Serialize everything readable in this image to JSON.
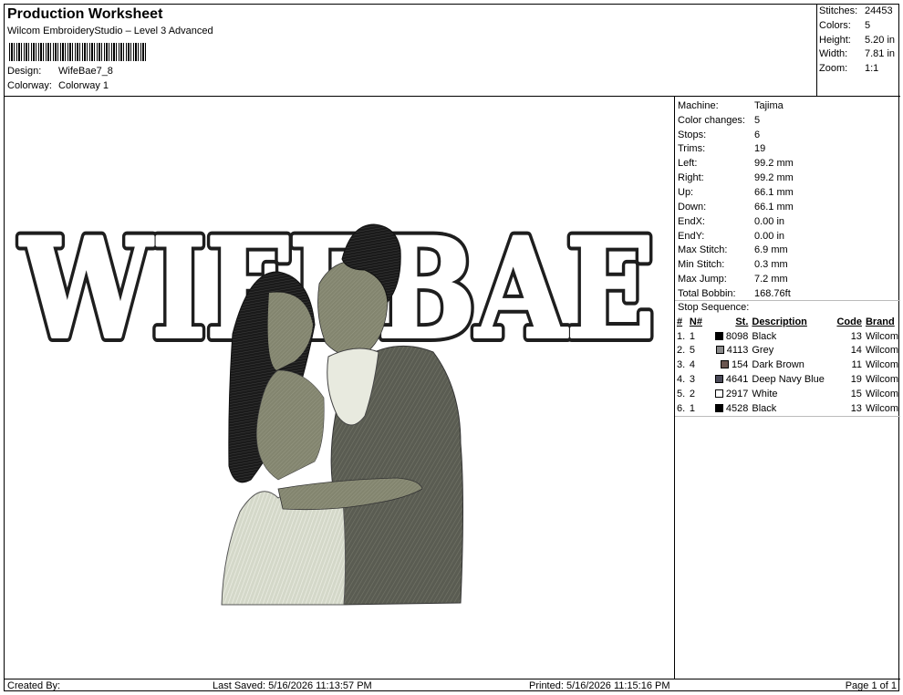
{
  "header": {
    "title": "Production Worksheet",
    "subtitle": "Wilcom EmbroideryStudio – Level 3 Advanced",
    "design_label": "Design:",
    "design_value": "WifeBae7_8",
    "colorway_label": "Colorway:",
    "colorway_value": "Colorway 1"
  },
  "stats": [
    {
      "label": "Stitches:",
      "value": "24453"
    },
    {
      "label": "Colors:",
      "value": "5"
    },
    {
      "label": "Height:",
      "value": "5.20 in"
    },
    {
      "label": "Width:",
      "value": "7.81 in"
    },
    {
      "label": "Zoom:",
      "value": "1:1"
    }
  ],
  "machine_info": [
    {
      "label": "Machine:",
      "value": "Tajima"
    },
    {
      "label": "Color changes:",
      "value": "5"
    },
    {
      "label": "Stops:",
      "value": "6"
    },
    {
      "label": "Trims:",
      "value": "19"
    },
    {
      "label": "Left:",
      "value": "99.2 mm"
    },
    {
      "label": "Right:",
      "value": "99.2 mm"
    },
    {
      "label": "Up:",
      "value": "66.1 mm"
    },
    {
      "label": "Down:",
      "value": "66.1 mm"
    },
    {
      "label": "EndX:",
      "value": "0.00 in"
    },
    {
      "label": "EndY:",
      "value": "0.00 in"
    },
    {
      "label": "Max Stitch:",
      "value": "6.9 mm"
    },
    {
      "label": "Min Stitch:",
      "value": "0.3 mm"
    },
    {
      "label": "Max Jump:",
      "value": "7.2 mm"
    },
    {
      "label": "Total Bobbin:",
      "value": "168.76ft"
    }
  ],
  "stop_sequence": {
    "title": "Stop Sequence:",
    "columns": [
      "#",
      "N#",
      "St.",
      "Description",
      "Code",
      "Brand"
    ],
    "rows": [
      {
        "idx": "1.",
        "n": "1",
        "st": "8098",
        "desc": "Black",
        "code": "13",
        "brand": "Wilcom",
        "color": "#000000"
      },
      {
        "idx": "2.",
        "n": "5",
        "st": "4113",
        "desc": "Grey",
        "code": "14",
        "brand": "Wilcom",
        "color": "#8c8c8c"
      },
      {
        "idx": "3.",
        "n": "4",
        "st": "154",
        "desc": "Dark Brown",
        "code": "11",
        "brand": "Wilcom",
        "color": "#6a5650"
      },
      {
        "idx": "4.",
        "n": "3",
        "st": "4641",
        "desc": "Deep Navy Blue",
        "code": "19",
        "brand": "Wilcom",
        "color": "#4a4a58"
      },
      {
        "idx": "5.",
        "n": "2",
        "st": "2917",
        "desc": "White",
        "code": "15",
        "brand": "Wilcom",
        "color": "#ffffff"
      },
      {
        "idx": "6.",
        "n": "1",
        "st": "4528",
        "desc": "Black",
        "code": "13",
        "brand": "Wilcom",
        "color": "#000000"
      }
    ]
  },
  "design_text": "WIFEBAE",
  "footer": {
    "created": "Created By:",
    "last_saved": "Last Saved: 5/16/2026 11:13:57 PM",
    "printed": "Printed: 5/16/2026 11:15:16 PM",
    "page": "Page 1 of 1"
  }
}
